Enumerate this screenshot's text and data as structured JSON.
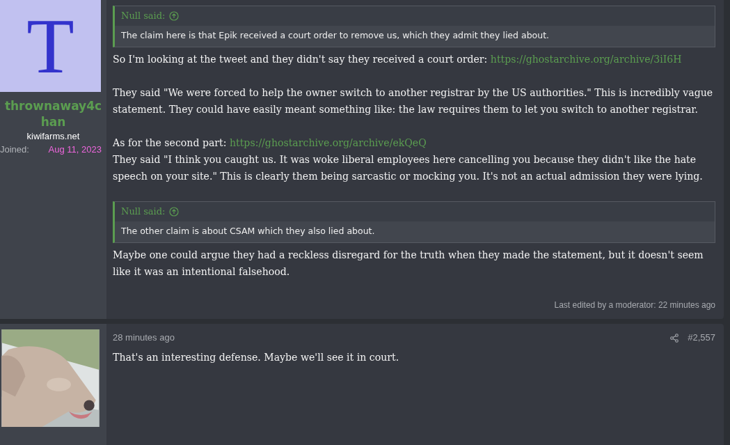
{
  "posts": [
    {
      "avatar": {
        "kind": "letter",
        "letter": "T"
      },
      "username": "thrownaway4chan",
      "site": "kiwifarms.net",
      "joined_label": "Joined:",
      "joined_date": "Aug 11, 2023",
      "blocks": [
        {
          "kind": "quote",
          "author": "Null said:",
          "text": "The claim here is that Epik received a court order to remove us, which they admit they lied about."
        },
        {
          "kind": "para",
          "parts": [
            {
              "text": "So I'm looking at the tweet and they didn't say they received a court order: "
            },
            {
              "link": "https://ghostarchive.org/archive/3iI6H"
            }
          ]
        },
        {
          "kind": "para",
          "parts": [
            {
              "text": "They said \"We were forced to help the owner switch to another registrar by the US authorities.\" This is incredibly vague statement. They could have easily meant something like: the law requires them to let you switch to another registrar."
            }
          ]
        },
        {
          "kind": "lines",
          "lines": [
            [
              {
                "text": "As for the second part: "
              },
              {
                "link": "https://ghostarchive.org/archive/ekQeQ"
              }
            ],
            [
              {
                "text": "They said \"I think you caught us. It was woke liberal employees here cancelling you because they didn't like the hate speech on your site.\" This is clearly them being sarcastic or mocking you. It's not an actual admission they were lying."
              }
            ]
          ]
        },
        {
          "kind": "quote",
          "author": "Null said:",
          "text": "The other claim is about CSAM which they also lied about."
        },
        {
          "kind": "para",
          "parts": [
            {
              "text": "Maybe one could argue they had a reckless disregard for the truth when they made the statement, but it doesn't seem like it was an intentional falsehood."
            }
          ]
        }
      ],
      "edited": "Last edited by a moderator: 22 minutes ago"
    },
    {
      "avatar": {
        "kind": "picture"
      },
      "time": "28 minutes ago",
      "number": "#2,557",
      "blocks": [
        {
          "kind": "para",
          "parts": [
            {
              "text": "That's an interesting defense. Maybe we'll see it in court."
            }
          ]
        }
      ]
    }
  ]
}
